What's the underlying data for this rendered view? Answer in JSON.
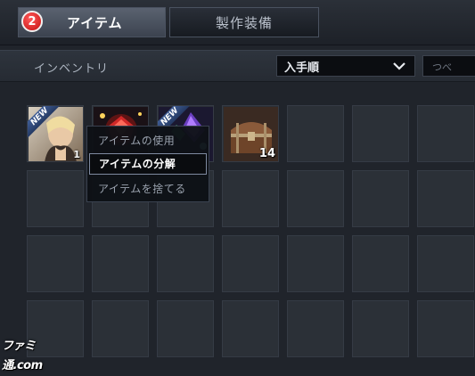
{
  "tabs": {
    "badge": "2",
    "items_label": "アイテム",
    "craft_label": "製作装備"
  },
  "inventory": {
    "title": "インベントリ",
    "sort_value": "入手順",
    "filter_partial": "つべ"
  },
  "slots": [
    {
      "kind": "character-card",
      "new": true,
      "new_label": "NEW",
      "count": "1"
    },
    {
      "kind": "red-gem",
      "new": false
    },
    {
      "kind": "crystal-card",
      "new": true,
      "new_label": "NEW"
    },
    {
      "kind": "treasure-chest",
      "new": false,
      "count": "14"
    }
  ],
  "context_menu": {
    "items": [
      {
        "label": "アイテムの使用",
        "active": false
      },
      {
        "label": "アイテムの分解",
        "active": true
      },
      {
        "label": "アイテムを捨てる",
        "active": false
      }
    ]
  },
  "watermark": "ファミ通.com",
  "colors": {
    "badge_red": "#d41818",
    "new_blue": "#2f4a7d",
    "background": "#20242b"
  }
}
